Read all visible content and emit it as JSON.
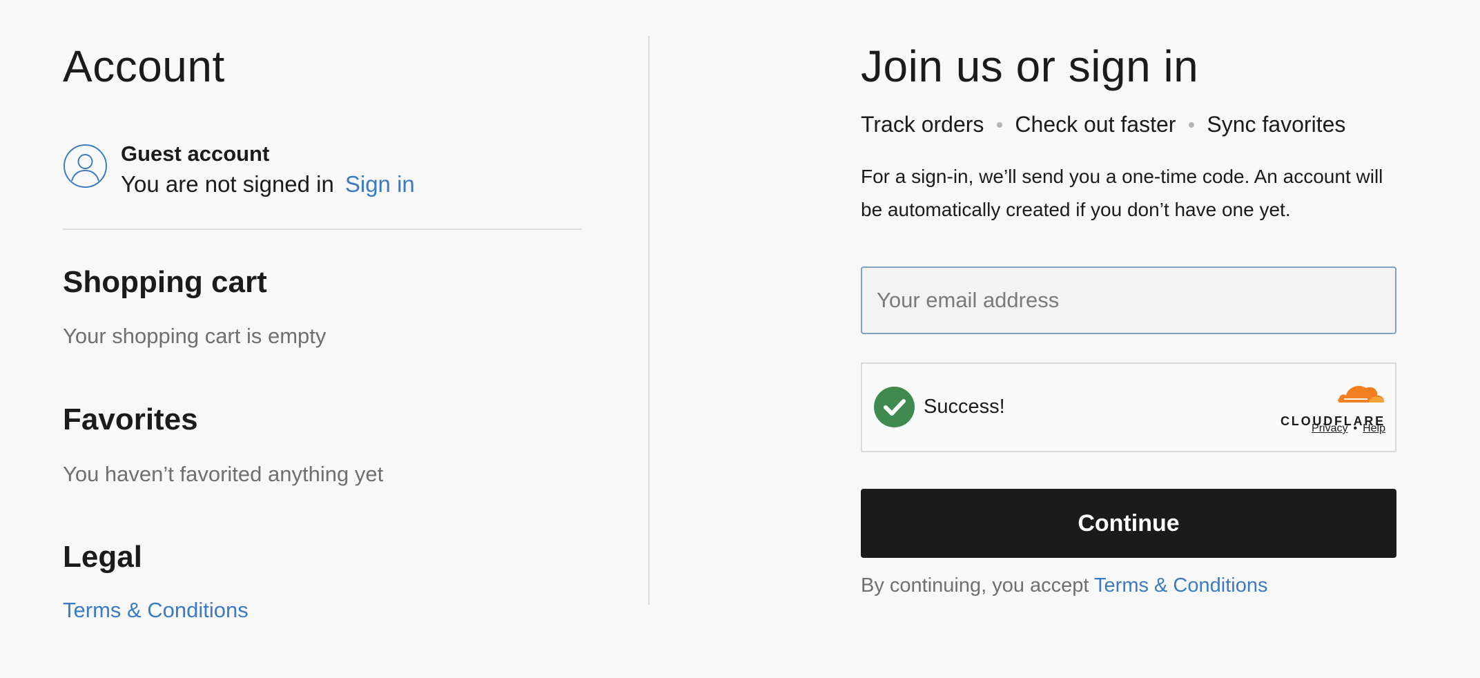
{
  "account": {
    "title": "Account",
    "guest": {
      "title": "Guest account",
      "status": "You are not signed in",
      "sign_in_label": "Sign in",
      "avatar_icon": "user-outline-icon"
    },
    "cart": {
      "title": "Shopping cart",
      "text": "Your shopping cart is empty"
    },
    "favorites": {
      "title": "Favorites",
      "text": "You haven’t favorited anything yet"
    },
    "legal": {
      "title": "Legal",
      "link": "Terms & Conditions"
    }
  },
  "signin": {
    "title": "Join us or sign in",
    "benefits": [
      "Track orders",
      "Check out faster",
      "Sync favorites"
    ],
    "description": "For a sign-in, we’ll send you a one-time code. An account will be automatically created if you don’t have one yet.",
    "email": {
      "value": "",
      "placeholder": "Your email address"
    },
    "captcha": {
      "status": "Success!",
      "status_icon": "check-circle-icon",
      "brand": "CLOUDFLARE",
      "brand_icon": "cloudflare-cloud-icon",
      "privacy_label": "Privacy",
      "separator": "•",
      "help_label": "Help"
    },
    "continue_label": "Continue",
    "accept_prefix": "By continuing, you accept",
    "accept_link": "Terms & Conditions"
  },
  "colors": {
    "background": "#f8f8f8",
    "text": "#1b1b1b",
    "muted_text": "#6f6f6f",
    "link": "#3c7bc0",
    "button": "#1b1b1b",
    "success_green": "#3e8a4f",
    "cloudflare_orange": "#f38020"
  }
}
